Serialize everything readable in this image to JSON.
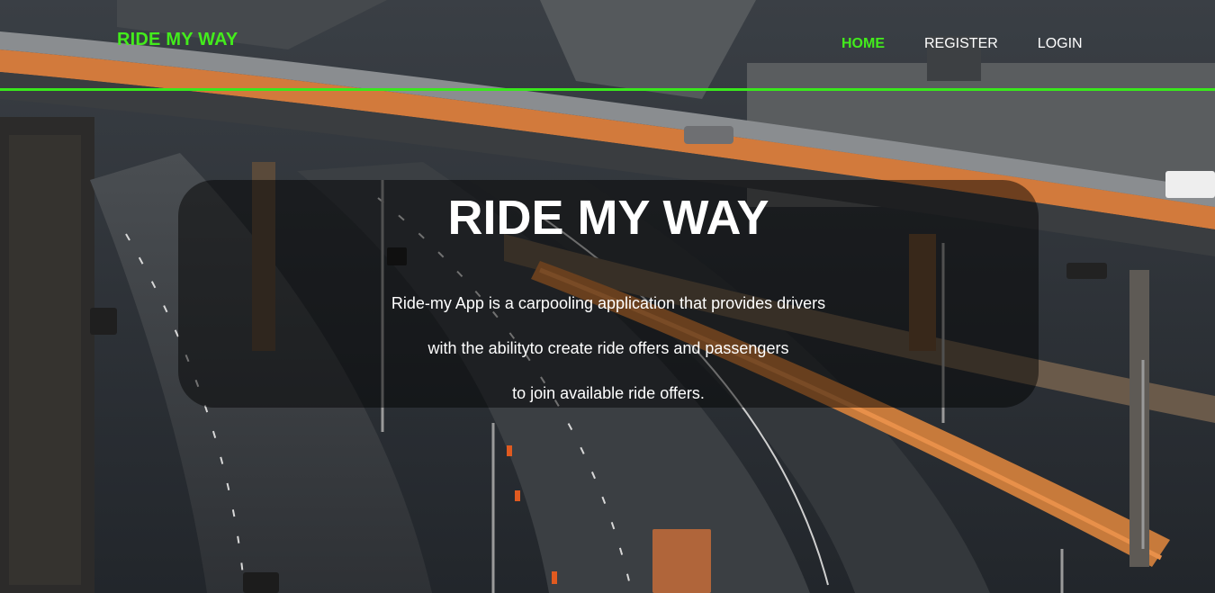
{
  "navbar": {
    "brand": "RIDE MY WAY",
    "links": [
      {
        "label": "HOME",
        "active": true
      },
      {
        "label": "REGISTER",
        "active": false
      },
      {
        "label": "LOGIN",
        "active": false
      }
    ],
    "accent_color": "#43ec1c"
  },
  "hero": {
    "title": "RIDE MY WAY",
    "description_lines": [
      "Ride-my App is a carpooling application that provides drivers",
      "with the abilityto create ride offers and passengers",
      "to join available ride offers."
    ]
  }
}
